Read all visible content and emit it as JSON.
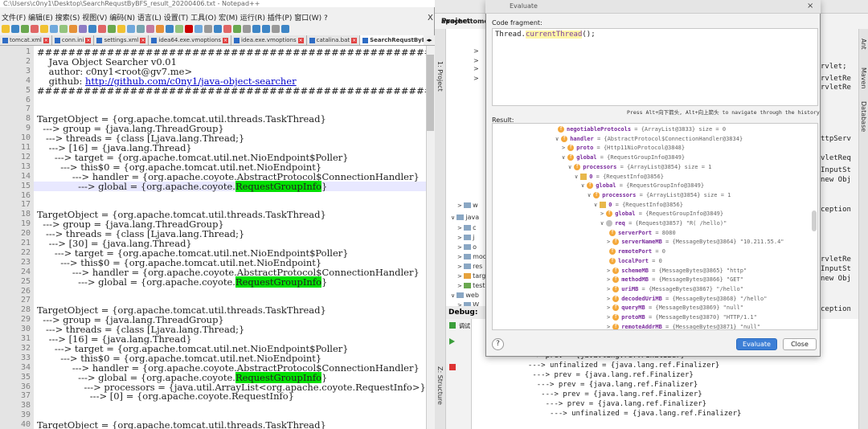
{
  "npp": {
    "title": "C:\\Users\\c0ny1\\Desktop\\SearchRequstByBFS_result_20200406.txt - Notepad++",
    "menu": "文件(F) 编辑(E) 搜索(S) 视图(V) 编码(N) 语言(L) 设置(T) 工具(O) 宏(M) 运行(R) 插件(P) 窗口(W) ?",
    "close_glyph": "X",
    "tabs": [
      "tomcat.xml",
      "conn.ini",
      "settings.xml",
      "idea64.exe.vmoptions",
      "idea.exe.vmoptions",
      "catalina.bat",
      "SearchRequstByBFS_resul"
    ],
    "tab_scroll": "◂▸",
    "lines": [
      {
        "n": "1",
        "t": "###############################################################################"
      },
      {
        "n": "2",
        "t": "    Java Object Searcher v0.01"
      },
      {
        "n": "3",
        "t": "    author: c0ny1<root@gv7.me>"
      },
      {
        "n": "4",
        "pre": "    github: ",
        "link": "http://github.com/c0ny1/java-object-searcher"
      },
      {
        "n": "5",
        "t": "###############################################################################"
      },
      {
        "n": "6",
        "t": ""
      },
      {
        "n": "7",
        "t": ""
      },
      {
        "n": "8",
        "t": "TargetObject = {org.apache.tomcat.util.threads.TaskThread}"
      },
      {
        "n": "9",
        "t": "  ---> group = {java.lang.ThreadGroup}"
      },
      {
        "n": "10",
        "t": "   ---> threads = {class [Ljava.lang.Thread;}"
      },
      {
        "n": "11",
        "t": "    ---> [16] = {java.lang.Thread}"
      },
      {
        "n": "12",
        "t": "      ---> target = {org.apache.tomcat.util.net.NioEndpoint$Poller}"
      },
      {
        "n": "13",
        "t": "        ---> this$0 = {org.apache.tomcat.util.net.NioEndpoint}"
      },
      {
        "n": "14",
        "t": "            ---> handler = {org.apache.coyote.AbstractProtocol$ConnectionHandler}"
      },
      {
        "n": "15",
        "pre": "              ---> global = {org.apache.coyote.",
        "green": "RequestGroupInfo",
        "post": "}",
        "hl": true
      },
      {
        "n": "16",
        "t": ""
      },
      {
        "n": "17",
        "t": ""
      },
      {
        "n": "18",
        "t": "TargetObject = {org.apache.tomcat.util.threads.TaskThread}"
      },
      {
        "n": "19",
        "t": "  ---> group = {java.lang.ThreadGroup}"
      },
      {
        "n": "20",
        "t": "   ---> threads = {class [Ljava.lang.Thread;}"
      },
      {
        "n": "21",
        "t": "    ---> [30] = {java.lang.Thread}"
      },
      {
        "n": "22",
        "t": "      ---> target = {org.apache.tomcat.util.net.NioEndpoint$Poller}"
      },
      {
        "n": "23",
        "t": "        ---> this$0 = {org.apache.tomcat.util.net.NioEndpoint}"
      },
      {
        "n": "24",
        "t": "            ---> handler = {org.apache.coyote.AbstractProtocol$ConnectionHandler}"
      },
      {
        "n": "25",
        "pre": "              ---> global = {org.apache.coyote.",
        "green": "RequestGroupInfo",
        "post": "}"
      },
      {
        "n": "26",
        "t": ""
      },
      {
        "n": "27",
        "t": ""
      },
      {
        "n": "28",
        "t": "TargetObject = {org.apache.tomcat.util.threads.TaskThread}"
      },
      {
        "n": "29",
        "t": "  ---> group = {java.lang.ThreadGroup}"
      },
      {
        "n": "30",
        "t": "   ---> threads = {class [Ljava.lang.Thread;}"
      },
      {
        "n": "31",
        "t": "    ---> [16] = {java.lang.Thread}"
      },
      {
        "n": "32",
        "t": "      ---> target = {org.apache.tomcat.util.net.NioEndpoint$Poller}"
      },
      {
        "n": "33",
        "t": "        ---> this$0 = {org.apache.tomcat.util.net.NioEndpoint}"
      },
      {
        "n": "34",
        "t": "            ---> handler = {org.apache.coyote.AbstractProtocol$ConnectionHandler}"
      },
      {
        "n": "35",
        "pre": "              ---> global = {org.apache.coyote.",
        "green": "RequestGroupInfo",
        "post": "}"
      },
      {
        "n": "36",
        "t": "                ---> processors = {java.util.ArrayList<org.apache.coyote.RequestInfo>}"
      },
      {
        "n": "37",
        "t": "                  ---> [0] = {org.apache.coyote.RequestInfo}"
      },
      {
        "n": "38",
        "t": ""
      },
      {
        "n": "39",
        "t": ""
      },
      {
        "n": "40",
        "t": "TargetObject = {org.apache.tomcat.util.threads.TaskThread}"
      }
    ]
  },
  "ij": {
    "window_title": "apache-tomcat",
    "project_label": "Project",
    "project_tool": "1: Project",
    "structure_tool": "Z: Structure",
    "tree": [
      "w",
      "java",
      "c",
      "j",
      "o",
      "modu",
      "res",
      "targ",
      "test",
      "web",
      "W"
    ],
    "debug_label": "Debug:",
    "debug_tab": "调试",
    "right_snippets": [
      "rvlet;",
      "rvletRe",
      "rvletRe",
      "ttpServ",
      "vletReq",
      "InputSt",
      "new Obj",
      "ception",
      "rvletRe",
      "InputSt",
      "new Obj",
      "ception"
    ],
    "right_tools": [
      "Ant",
      "Maven",
      "Database"
    ],
    "debug_lines": [
      "      ---> prev = {java.lang.ref.Finalizer}",
      "       ---> unfinalized = {java.lang.ref.Finalizer}",
      "        ---> prev = {java.lang.ref.Finalizer}",
      "         ---> prev = {java.lang.ref.Finalizer}",
      "          ---> prev = {java.lang.ref.Finalizer}",
      "           ---> prev = {java.lang.ref.Finalizer}",
      "            ---> unfinalized = {java.lang.ref.Finalizer}"
    ]
  },
  "dialog": {
    "title": "Evaluate",
    "close_glyph": "×",
    "fragment_label": "Code fragment:",
    "fragment_pre": "Thread.",
    "fragment_method": "currentThread",
    "fragment_post": "();",
    "hint": "Press Alt+向下箭头, Alt+向上箭头 to navigate through the history",
    "result_label": "Result:",
    "results": [
      {
        "d": 0,
        "arr": "",
        "icon": "f",
        "name": "negotiableProtocols",
        "val": " = {ArrayList@3833}  size = 0"
      },
      {
        "d": 0,
        "arr": "∨",
        "icon": "f",
        "name": "handler",
        "val": " = {AbstractProtocol$ConnectionHandler@3834}"
      },
      {
        "d": 1,
        "arr": ">",
        "icon": "f",
        "name": "proto",
        "val": " = {Http11NioProtocol@3848}"
      },
      {
        "d": 1,
        "arr": "∨",
        "icon": "f",
        "name": "global",
        "val": " = {RequestGroupInfo@3849}"
      },
      {
        "d": 2,
        "arr": "∨",
        "icon": "f",
        "name": "processors",
        "val": " = {ArrayList@3854}  size = 1"
      },
      {
        "d": 3,
        "arr": "∨",
        "icon": "=",
        "name": "0",
        "val": " = {RequestInfo@3856}"
      },
      {
        "d": 4,
        "arr": "∨",
        "icon": "f",
        "name": "global",
        "val": " = {RequestGroupInfo@3849}"
      },
      {
        "d": 5,
        "arr": "∨",
        "icon": "f",
        "name": "processors",
        "val": " = {ArrayList@3854}  size = 1"
      },
      {
        "d": 6,
        "arr": "∨",
        "icon": "=",
        "name": "0",
        "val": " = {RequestInfo@3856}"
      },
      {
        "d": 7,
        "arr": ">",
        "icon": "f",
        "name": "global",
        "val": " = {RequestGroupInfo@3849}"
      },
      {
        "d": 7,
        "arr": "∨",
        "icon": "p",
        "name": "req",
        "val": " = {Request@3857} \"R( /hello)\""
      },
      {
        "d": 8,
        "arr": "",
        "icon": "f",
        "name": "serverPort",
        "val": " = 8080"
      },
      {
        "d": 8,
        "arr": ">",
        "icon": "f",
        "name": "serverNameMB",
        "val": " = {MessageBytes@3864} \"10.211.55.4\""
      },
      {
        "d": 8,
        "arr": "",
        "icon": "f",
        "name": "remotePort",
        "val": " = 0"
      },
      {
        "d": 8,
        "arr": "",
        "icon": "f",
        "name": "localPort",
        "val": " = 0"
      },
      {
        "d": 8,
        "arr": ">",
        "icon": "f",
        "name": "schemeMB",
        "val": " = {MessageBytes@3865} \"http\""
      },
      {
        "d": 8,
        "arr": ">",
        "icon": "f",
        "name": "methodMB",
        "val": " = {MessageBytes@3866} \"GET\""
      },
      {
        "d": 8,
        "arr": ">",
        "icon": "f",
        "name": "uriMB",
        "val": " = {MessageBytes@3867} \"/hello\""
      },
      {
        "d": 8,
        "arr": ">",
        "icon": "f",
        "name": "decodedUriMB",
        "val": " = {MessageBytes@3868} \"/hello\""
      },
      {
        "d": 8,
        "arr": ">",
        "icon": "f",
        "name": "queryMB",
        "val": " = {MessageBytes@3869} \"null\""
      },
      {
        "d": 8,
        "arr": ">",
        "icon": "f",
        "name": "protoMB",
        "val": " = {MessageBytes@3870} \"HTTP/1.1\""
      },
      {
        "d": 8,
        "arr": ">",
        "icon": "f",
        "name": "remoteAddrMB",
        "val": " = {MessageBytes@3871} \"null\""
      }
    ],
    "help": "?",
    "evaluate": "Evaluate",
    "close": "Close"
  }
}
